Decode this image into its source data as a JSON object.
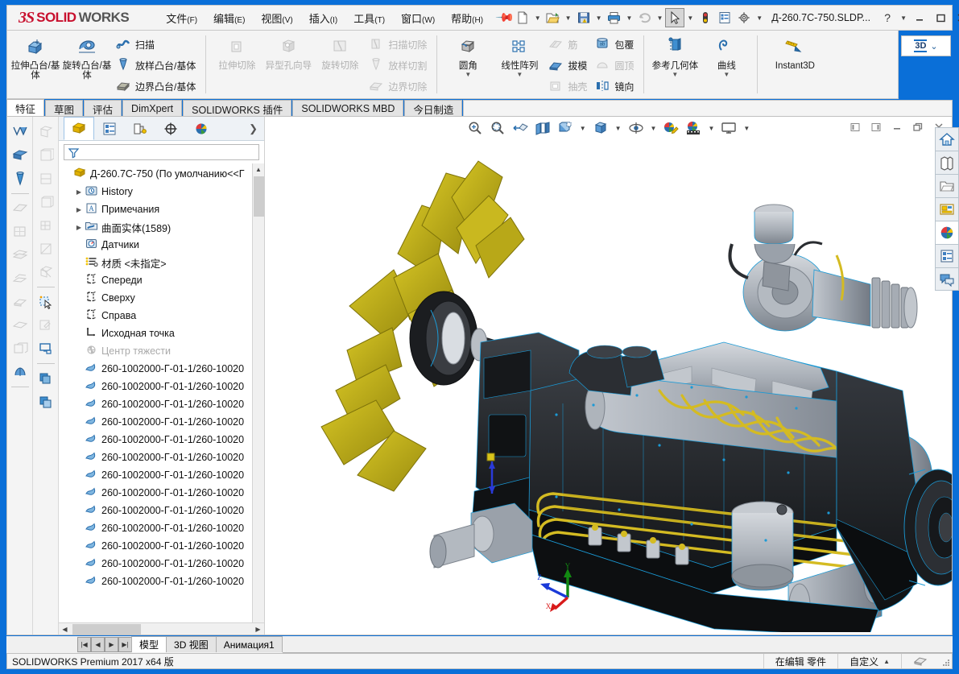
{
  "app": {
    "brand_ds": "3S",
    "brand_solid": "SOLID",
    "brand_works": "WORKS",
    "document_name": "Д-260.7С-750.SLDP...",
    "badge_3d": "3D",
    "accent_color": "#0a6fd8",
    "brand_color": "#c8102e"
  },
  "menubar": {
    "items": [
      {
        "label": "文件",
        "mnemonic": "(F)"
      },
      {
        "label": "编辑",
        "mnemonic": "(E)"
      },
      {
        "label": "视图",
        "mnemonic": "(V)"
      },
      {
        "label": "插入",
        "mnemonic": "(I)"
      },
      {
        "label": "工具",
        "mnemonic": "(T)"
      },
      {
        "label": "窗口",
        "mnemonic": "(W)"
      },
      {
        "label": "帮助",
        "mnemonic": "(H)"
      }
    ],
    "pin_icon": "pushpin-icon"
  },
  "titlebar_icons": [
    {
      "name": "new-document-icon"
    },
    {
      "name": "open-document-icon"
    },
    {
      "name": "save-icon"
    },
    {
      "name": "print-icon"
    },
    {
      "name": "undo-icon"
    },
    {
      "name": "select-arrow-icon"
    },
    {
      "name": "rebuild-icon"
    },
    {
      "name": "options-list-icon"
    },
    {
      "name": "settings-gear-icon"
    }
  ],
  "window_controls": {
    "help": "?",
    "minimize": "minimize-icon",
    "maximize": "maximize-icon",
    "close": "close-icon"
  },
  "ribbon": {
    "groups": [
      {
        "name": "boss-base-group",
        "big": [
          {
            "label": "拉伸凸台/基体",
            "icon": "extrude-boss-icon",
            "disabled": false
          },
          {
            "label": "旋转凸台/基体",
            "icon": "revolve-boss-icon",
            "disabled": false
          }
        ],
        "small": [
          {
            "label": "扫描",
            "icon": "sweep-icon",
            "disabled": false
          },
          {
            "label": "放样凸台/基体",
            "icon": "loft-boss-icon",
            "disabled": false
          },
          {
            "label": "边界凸台/基体",
            "icon": "boundary-boss-icon",
            "disabled": false
          }
        ]
      },
      {
        "name": "cut-group",
        "big": [
          {
            "label": "拉伸切除",
            "icon": "extrude-cut-icon",
            "disabled": true
          },
          {
            "label": "异型孔向导",
            "icon": "hole-wizard-icon",
            "disabled": true
          },
          {
            "label": "旋转切除",
            "icon": "revolve-cut-icon",
            "disabled": true
          }
        ],
        "small": [
          {
            "label": "扫描切除",
            "icon": "sweep-cut-icon",
            "disabled": true
          },
          {
            "label": "放样切割",
            "icon": "loft-cut-icon",
            "disabled": true
          },
          {
            "label": "边界切除",
            "icon": "boundary-cut-icon",
            "disabled": true
          }
        ]
      },
      {
        "name": "feature-group",
        "big": [
          {
            "label": "圆角",
            "icon": "fillet-icon",
            "disabled": false,
            "dropdown": true
          },
          {
            "label": "线性阵列",
            "icon": "linear-pattern-icon",
            "disabled": false,
            "dropdown": true
          }
        ],
        "small": [
          {
            "label": "筋",
            "icon": "rib-icon",
            "disabled": true
          },
          {
            "label": "拔模",
            "icon": "draft-icon",
            "disabled": false
          },
          {
            "label": "抽壳",
            "icon": "shell-icon",
            "disabled": true
          }
        ],
        "small2": [
          {
            "label": "包覆",
            "icon": "wrap-icon",
            "disabled": false
          },
          {
            "label": "圆顶",
            "icon": "dome-icon",
            "disabled": true
          },
          {
            "label": "镜向",
            "icon": "mirror-icon",
            "disabled": false
          }
        ]
      },
      {
        "name": "reference-group",
        "big": [
          {
            "label": "参考几何体",
            "icon": "reference-geometry-icon",
            "disabled": false,
            "dropdown": true
          },
          {
            "label": "曲线",
            "icon": "curves-icon",
            "disabled": false,
            "dropdown": true
          }
        ]
      },
      {
        "name": "instant3d-group",
        "big": [
          {
            "label": "Instant3D",
            "icon": "instant3d-icon",
            "disabled": false
          }
        ]
      }
    ]
  },
  "tabs": {
    "items": [
      {
        "label": "特征",
        "active": true
      },
      {
        "label": "草图",
        "active": false
      },
      {
        "label": "评估",
        "active": false
      },
      {
        "label": "DimXpert",
        "active": false
      },
      {
        "label": "SOLIDWORKS 插件",
        "active": false
      },
      {
        "label": "SOLIDWORKS MBD",
        "active": false
      },
      {
        "label": "今日制造",
        "active": false
      }
    ]
  },
  "tree_panel": {
    "tabs": [
      {
        "name": "feature-manager-tab",
        "icon": "feature-tree-icon",
        "active": true
      },
      {
        "name": "property-manager-tab",
        "icon": "property-manager-icon",
        "active": false
      },
      {
        "name": "configuration-manager-tab",
        "icon": "configuration-icon",
        "active": false
      },
      {
        "name": "dimxpert-manager-tab",
        "icon": "dimxpert-icon",
        "active": false
      },
      {
        "name": "display-manager-tab",
        "icon": "display-manager-icon",
        "active": false
      }
    ],
    "more_icon": "chevron-right-icon",
    "filter_icon": "filter-funnel-icon",
    "filter_value": "",
    "filter_placeholder": "",
    "root": {
      "label": "Д-260.7С-750  (По умолчанию<<Г",
      "icon": "part-icon"
    },
    "items": [
      {
        "label": "History",
        "icon": "history-icon",
        "expandable": true,
        "indent": 1,
        "gray": false
      },
      {
        "label": "Примечания",
        "icon": "annotations-icon",
        "expandable": true,
        "indent": 1,
        "gray": false
      },
      {
        "label": "曲面实体(1589)",
        "icon": "surface-bodies-icon",
        "expandable": true,
        "indent": 1,
        "gray": false
      },
      {
        "label": "Датчики",
        "icon": "sensors-icon",
        "expandable": false,
        "indent": 1,
        "gray": false
      },
      {
        "label": "材质 <未指定>",
        "icon": "material-icon",
        "expandable": false,
        "indent": 1,
        "gray": false
      },
      {
        "label": "Спереди",
        "icon": "plane-icon",
        "expandable": false,
        "indent": 1,
        "gray": false
      },
      {
        "label": "Сверху",
        "icon": "plane-icon",
        "expandable": false,
        "indent": 1,
        "gray": false
      },
      {
        "label": "Справа",
        "icon": "plane-icon",
        "expandable": false,
        "indent": 1,
        "gray": false
      },
      {
        "label": "Исходная точка",
        "icon": "origin-icon",
        "expandable": false,
        "indent": 1,
        "gray": false
      },
      {
        "label": "Центр тяжести",
        "icon": "center-of-mass-icon",
        "expandable": false,
        "indent": 1,
        "gray": true
      },
      {
        "label": "260-1002000-Г-01-1/260-10020",
        "icon": "surface-body-icon",
        "expandable": false,
        "indent": 1,
        "gray": false
      },
      {
        "label": "260-1002000-Г-01-1/260-10020",
        "icon": "surface-body-icon",
        "expandable": false,
        "indent": 1,
        "gray": false
      },
      {
        "label": "260-1002000-Г-01-1/260-10020",
        "icon": "surface-body-icon",
        "expandable": false,
        "indent": 1,
        "gray": false
      },
      {
        "label": "260-1002000-Г-01-1/260-10020",
        "icon": "surface-body-icon",
        "expandable": false,
        "indent": 1,
        "gray": false
      },
      {
        "label": "260-1002000-Г-01-1/260-10020",
        "icon": "surface-body-icon",
        "expandable": false,
        "indent": 1,
        "gray": false
      },
      {
        "label": "260-1002000-Г-01-1/260-10020",
        "icon": "surface-body-icon",
        "expandable": false,
        "indent": 1,
        "gray": false
      },
      {
        "label": "260-1002000-Г-01-1/260-10020",
        "icon": "surface-body-icon",
        "expandable": false,
        "indent": 1,
        "gray": false
      },
      {
        "label": "260-1002000-Г-01-1/260-10020",
        "icon": "surface-body-icon",
        "expandable": false,
        "indent": 1,
        "gray": false
      },
      {
        "label": "260-1002000-Г-01-1/260-10020",
        "icon": "surface-body-icon",
        "expandable": false,
        "indent": 1,
        "gray": false
      },
      {
        "label": "260-1002000-Г-01-1/260-10020",
        "icon": "surface-body-icon",
        "expandable": false,
        "indent": 1,
        "gray": false
      },
      {
        "label": "260-1002000-Г-01-1/260-10020",
        "icon": "surface-body-icon",
        "expandable": false,
        "indent": 1,
        "gray": false
      },
      {
        "label": "260-1002000-Г-01-1/260-10020",
        "icon": "surface-body-icon",
        "expandable": false,
        "indent": 1,
        "gray": false
      },
      {
        "label": "260-1002000-Г-01-1/260-10020",
        "icon": "surface-body-icon",
        "expandable": false,
        "indent": 1,
        "gray": false
      }
    ]
  },
  "view_toolbar": {
    "items": [
      {
        "name": "zoom-to-fit-icon"
      },
      {
        "name": "zoom-to-area-icon"
      },
      {
        "name": "previous-view-icon"
      },
      {
        "name": "section-view-icon"
      },
      {
        "name": "view-orientation-icon"
      },
      {
        "name": "display-style-icon"
      },
      {
        "name": "hide-show-items-icon"
      },
      {
        "name": "edit-appearance-icon"
      },
      {
        "name": "apply-scene-icon"
      },
      {
        "name": "view-settings-icon"
      }
    ]
  },
  "doc_window_controls": [
    {
      "name": "restore-left-icon"
    },
    {
      "name": "restore-right-icon"
    },
    {
      "name": "doc-minimize-icon"
    },
    {
      "name": "doc-restore-icon"
    },
    {
      "name": "doc-close-icon"
    }
  ],
  "task_pane": {
    "buttons": [
      {
        "name": "solidworks-resources-icon",
        "active": false
      },
      {
        "name": "design-library-icon",
        "active": false
      },
      {
        "name": "file-explorer-icon",
        "active": false
      },
      {
        "name": "view-palette-icon",
        "active": false
      },
      {
        "name": "appearances-scenes-icon",
        "active": true
      },
      {
        "name": "custom-properties-icon",
        "active": false
      },
      {
        "name": "sw-forum-icon",
        "active": false
      }
    ]
  },
  "triad": {
    "x_label": "X",
    "y_label": "Y",
    "z_label": "Z",
    "x_color": "#d81a1a",
    "y_color": "#128a12",
    "z_color": "#1a3ad8"
  },
  "bottom_tabs": {
    "nav": [
      {
        "name": "first-tab-icon",
        "glyph": "|◀"
      },
      {
        "name": "prev-tab-icon",
        "glyph": "◀"
      },
      {
        "name": "next-tab-icon",
        "glyph": "▶"
      },
      {
        "name": "last-tab-icon",
        "glyph": "▶|"
      }
    ],
    "items": [
      {
        "label": "模型",
        "active": true
      },
      {
        "label": "3D 视图",
        "active": false
      },
      {
        "label": "Анимация1",
        "active": false
      }
    ]
  },
  "statusbar": {
    "left_text": "SOLIDWORKS Premium 2017 x64 版",
    "editing_text": "在编辑 零件",
    "custom_text": "自定义",
    "custom_arrow": "▲",
    "icon": "overlay-icon"
  }
}
